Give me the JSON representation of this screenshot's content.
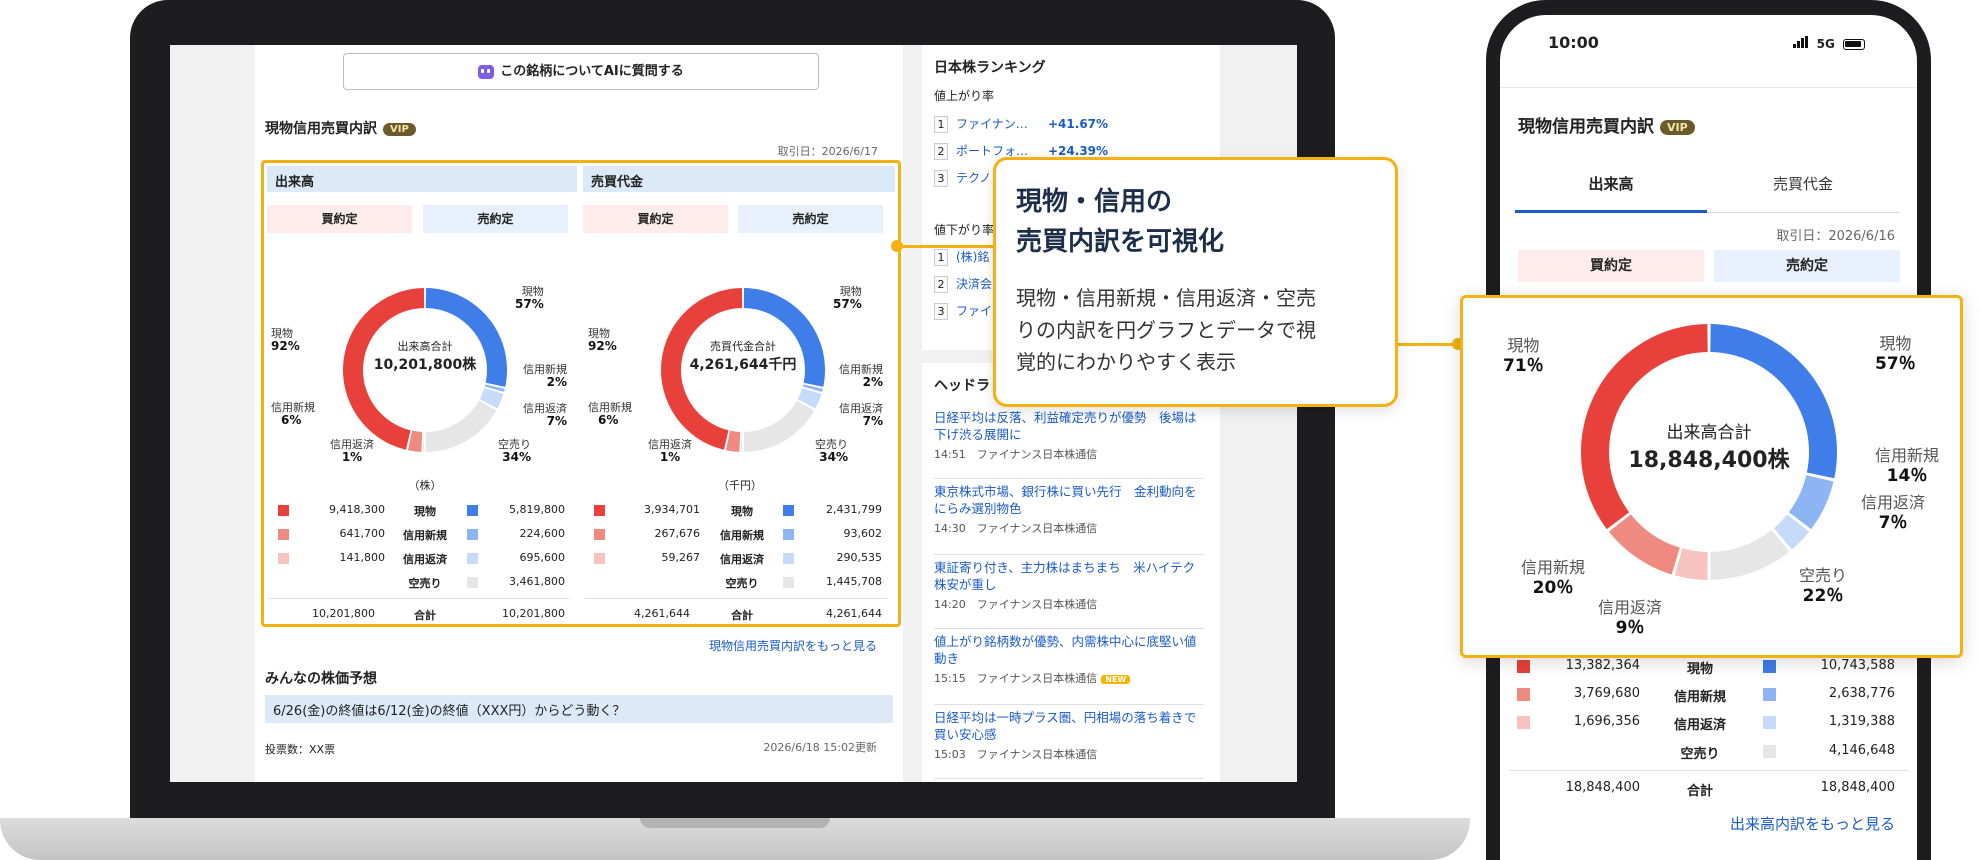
{
  "desktop": {
    "ai_button": "この銘柄についてAIに質問する",
    "section_title": "現物信用売買内訳",
    "vip": "VIP",
    "date": "取引日：2026/6/17",
    "volume_panel": {
      "header": "出来高",
      "buy": "買約定",
      "sell": "売約定",
      "center_label": "出来高合計",
      "center_value": "10,201,800株",
      "unit": "（株）",
      "left_labels": [
        {
          "name": "現物",
          "pct": "92%"
        },
        {
          "name": "信用新規",
          "pct": "6%"
        },
        {
          "name": "信用返済",
          "pct": "1%"
        }
      ],
      "right_labels": [
        {
          "name": "現物",
          "pct": "57%"
        },
        {
          "name": "信用新規",
          "pct": "2%"
        },
        {
          "name": "信用返済",
          "pct": "7%"
        },
        {
          "name": "空売り",
          "pct": "34%"
        }
      ],
      "rows": [
        {
          "buy": "9,418,300",
          "label": "現物",
          "sell": "5,819,800"
        },
        {
          "buy": "641,700",
          "label": "信用新規",
          "sell": "224,600"
        },
        {
          "buy": "141,800",
          "label": "信用返済",
          "sell": "695,600"
        },
        {
          "buy": "",
          "label": "空売り",
          "sell": "3,461,800"
        }
      ],
      "total": {
        "buy": "10,201,800",
        "label": "合計",
        "sell": "10,201,800"
      }
    },
    "value_panel": {
      "header": "売買代金",
      "buy": "買約定",
      "sell": "売約定",
      "center_label": "売買代金合計",
      "center_value": "4,261,644千円",
      "unit": "（千円）",
      "left_labels": [
        {
          "name": "現物",
          "pct": "92%"
        },
        {
          "name": "信用新規",
          "pct": "6%"
        },
        {
          "name": "信用返済",
          "pct": "1%"
        }
      ],
      "right_labels": [
        {
          "name": "現物",
          "pct": "57%"
        },
        {
          "name": "信用新規",
          "pct": "2%"
        },
        {
          "name": "信用返済",
          "pct": "7%"
        },
        {
          "name": "空売り",
          "pct": "34%"
        }
      ],
      "rows": [
        {
          "buy": "3,934,701",
          "label": "現物",
          "sell": "2,431,799"
        },
        {
          "buy": "267,676",
          "label": "信用新規",
          "sell": "93,602"
        },
        {
          "buy": "59,267",
          "label": "信用返済",
          "sell": "290,535"
        },
        {
          "buy": "",
          "label": "空売り",
          "sell": "1,445,708"
        }
      ],
      "total": {
        "buy": "4,261,644",
        "label": "合計",
        "sell": "4,261,644"
      }
    },
    "more_link": "現物信用売買内訳をもっと見る",
    "forecast_title": "みんなの株価予想",
    "forecast_question": "6/26(金)の終値は6/12(金)の終値（XXX円）からどう動く？",
    "votes": "投票数：XX票",
    "updated": "2026/6/18 15:02更新"
  },
  "ranking": {
    "title": "日本株ランキング",
    "up_label": "値上がり率",
    "up_items": [
      {
        "rank": "1",
        "name": "ファイナン…",
        "value": "+41.67%"
      },
      {
        "rank": "2",
        "name": "ポートフォ…",
        "value": "+24.39%"
      },
      {
        "rank": "3",
        "name": "テクノ",
        "value": ""
      }
    ],
    "down_label": "値下がり率",
    "down_items": [
      {
        "rank": "1",
        "name": "(株)銘",
        "value": ""
      },
      {
        "rank": "2",
        "name": "決済会",
        "value": ""
      },
      {
        "rank": "3",
        "name": "ファイ",
        "value": ""
      }
    ]
  },
  "headlines": {
    "title": "ヘッドラ",
    "items": [
      {
        "text": "日経平均は反落、利益確定売りが優勢　後場は下げ渋る展開に",
        "time": "14:51",
        "source": "ファイナンス日本株通信",
        "new": ""
      },
      {
        "text": "東京株式市場、銀行株に買い先行　金利動向をにらみ選別物色",
        "time": "14:30",
        "source": "ファイナンス日本株通信",
        "new": ""
      },
      {
        "text": "東証寄り付き、主力株はまちまち　米ハイテク株安が重し",
        "time": "14:20",
        "source": "ファイナンス日本株通信",
        "new": ""
      },
      {
        "text": "値上がり銘柄数が優勢、内需株中心に底堅い値動き",
        "time": "15:15",
        "source": "ファイナンス日本株通信",
        "new": "NEW"
      },
      {
        "text": "日経平均は一時プラス圏、円相場の落ち着きで買い安心感",
        "time": "15:03",
        "source": "ファイナンス日本株通信",
        "new": ""
      }
    ]
  },
  "callout": {
    "title_line1": "現物・信用の",
    "title_line2": "売買内訳を可視化",
    "body_line1": "現物・信用新規・信用返済・空売",
    "body_line2": "りの内訳を円グラフとデータで視",
    "body_line3": "覚的にわかりやすく表示"
  },
  "phone": {
    "time": "10:00",
    "network": "5G",
    "title": "現物信用売買内訳",
    "vip": "VIP",
    "tab_volume": "出来高",
    "tab_value": "売買代金",
    "date": "取引日：2026/6/16",
    "buy": "買約定",
    "sell": "売約定",
    "rows": [
      {
        "buy": "13,382,364",
        "label": "現物",
        "sell": "10,743,588"
      },
      {
        "buy": "3,769,680",
        "label": "信用新規",
        "sell": "2,638,776"
      },
      {
        "buy": "1,696,356",
        "label": "信用返済",
        "sell": "1,319,388"
      },
      {
        "buy": "",
        "label": "空売り",
        "sell": "4,146,648"
      }
    ],
    "total": {
      "buy": "18,848,400",
      "label": "合計",
      "sell": "18,848,400"
    },
    "more_link": "出来高内訳をもっと見る"
  },
  "zoom": {
    "center_label": "出来高合計",
    "center_value": "18,848,400株",
    "labels": {
      "left_spot": {
        "name": "現物",
        "pct": "71％"
      },
      "left_new": {
        "name": "信用新規",
        "pct": "20％"
      },
      "left_repay": {
        "name": "信用返済",
        "pct": "9％"
      },
      "right_spot": {
        "name": "現物",
        "pct": "57％"
      },
      "right_new": {
        "name": "信用新規",
        "pct": "14％"
      },
      "right_repay": {
        "name": "信用返済",
        "pct": "7％"
      },
      "right_short": {
        "name": "空売り",
        "pct": "22％"
      }
    }
  },
  "colors": {
    "buy_spot": "#e8413c",
    "buy_new": "#ef8a80",
    "buy_repay": "#f6c3bf",
    "sell_spot": "#3f7de8",
    "sell_new": "#8eb5f3",
    "sell_repay": "#c6dafa",
    "sell_short": "#e6e6e6",
    "accent": "#f5b013"
  },
  "chart_data": [
    {
      "type": "pie",
      "name_ref": "desktop-volume-donut",
      "buy_side": [
        {
          "label": "現物",
          "value": 92
        },
        {
          "label": "信用新規",
          "value": 6
        },
        {
          "label": "信用返済",
          "value": 1
        }
      ],
      "sell_side": [
        {
          "label": "現物",
          "value": 57
        },
        {
          "label": "信用新規",
          "value": 2
        },
        {
          "label": "信用返済",
          "value": 7
        },
        {
          "label": "空売り",
          "value": 34
        }
      ]
    },
    {
      "type": "pie",
      "name_ref": "desktop-value-donut",
      "buy_side": [
        {
          "label": "現物",
          "value": 92
        },
        {
          "label": "信用新規",
          "value": 6
        },
        {
          "label": "信用返済",
          "value": 1
        }
      ],
      "sell_side": [
        {
          "label": "現物",
          "value": 57
        },
        {
          "label": "信用新規",
          "value": 2
        },
        {
          "label": "信用返済",
          "value": 7
        },
        {
          "label": "空売り",
          "value": 34
        }
      ]
    },
    {
      "type": "pie",
      "name_ref": "zoom-volume-donut",
      "buy_side": [
        {
          "label": "現物",
          "value": 71
        },
        {
          "label": "信用新規",
          "value": 20
        },
        {
          "label": "信用返済",
          "value": 9
        }
      ],
      "sell_side": [
        {
          "label": "現物",
          "value": 57
        },
        {
          "label": "信用新規",
          "value": 14
        },
        {
          "label": "信用返済",
          "value": 7
        },
        {
          "label": "空売り",
          "value": 22
        }
      ]
    }
  ]
}
